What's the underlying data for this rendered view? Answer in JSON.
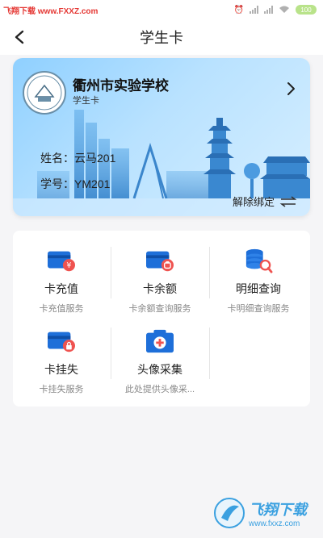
{
  "status_bar": {
    "watermark": "飞翔下载 www.FXXZ.com",
    "battery": "100"
  },
  "nav": {
    "title": "学生卡"
  },
  "card": {
    "school_name": "衢州市实验学校",
    "card_type": "学生卡",
    "name_line": "姓名：云马201",
    "id_line": "学号：YM201",
    "unbind_label": "解除绑定"
  },
  "services": [
    {
      "title": "卡充值",
      "subtitle": "卡充值服务",
      "icon": "card-recharge-icon"
    },
    {
      "title": "卡余额",
      "subtitle": "卡余额查询服务",
      "icon": "card-balance-icon"
    },
    {
      "title": "明细查询",
      "subtitle": "卡明细查询服务",
      "icon": "detail-search-icon"
    },
    {
      "title": "卡挂失",
      "subtitle": "卡挂失服务",
      "icon": "card-lost-icon"
    },
    {
      "title": "头像采集",
      "subtitle": "此处提供头像采...",
      "icon": "camera-icon"
    }
  ],
  "bottom_watermark": {
    "title": "飞翔下载",
    "site": "www.fxxz.com"
  },
  "colors": {
    "card_gradient_start": "#8fd0ff",
    "card_gradient_end": "#d7efff",
    "icon_blue": "#1e6fd9",
    "icon_red": "#ef5350"
  }
}
